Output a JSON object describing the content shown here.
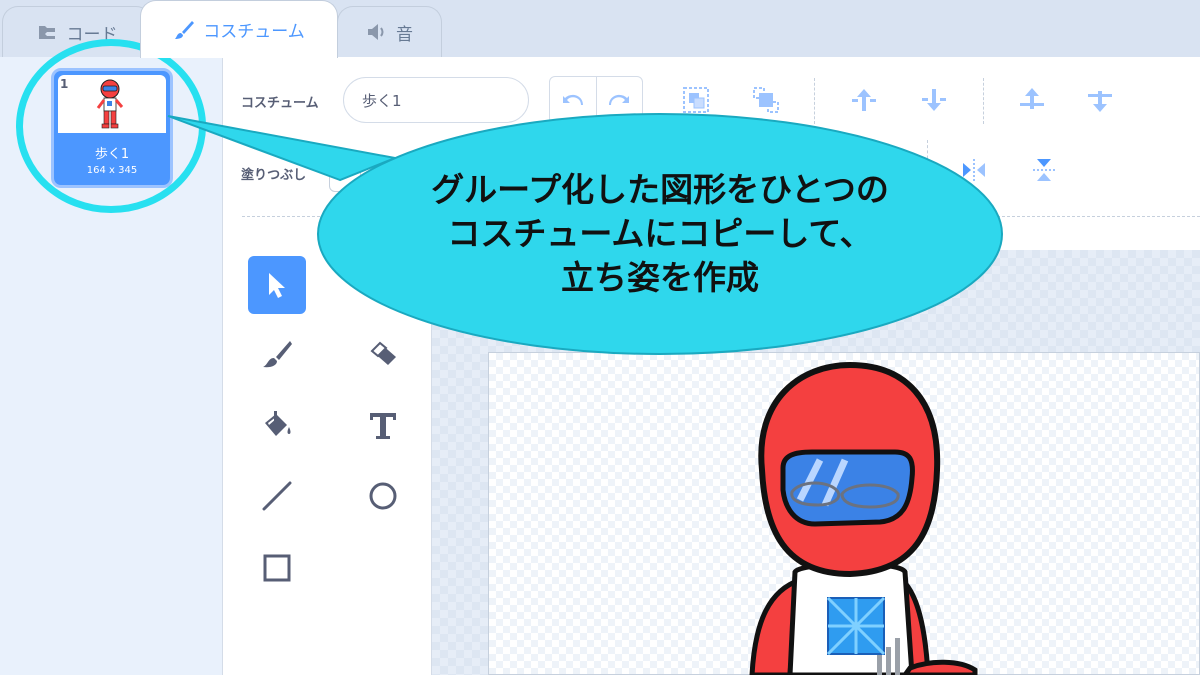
{
  "tabs": [
    {
      "label": "コード",
      "icon": "code-blocks-icon"
    },
    {
      "label": "コスチューム",
      "icon": "paintbrush-icon"
    },
    {
      "label": "音",
      "icon": "speaker-icon"
    }
  ],
  "costume_list": {
    "items": [
      {
        "number": "1",
        "name": "歩く1",
        "size": "164 x 345",
        "selected": true
      }
    ]
  },
  "editor": {
    "costume_label": "コスチューム",
    "costume_name": "歩く1",
    "fill_label": "塗りつぶし"
  },
  "tools": [
    {
      "name": "select-tool",
      "icon": "arrow-pointer-icon",
      "active": true
    },
    {
      "name": "brush-tool",
      "icon": "paintbrush-icon"
    },
    {
      "name": "eraser-tool",
      "icon": "eraser-icon"
    },
    {
      "name": "fill-tool",
      "icon": "paint-bucket-icon"
    },
    {
      "name": "text-tool",
      "icon": "text-t-icon"
    },
    {
      "name": "line-tool",
      "icon": "line-icon"
    },
    {
      "name": "circle-tool",
      "icon": "circle-icon"
    },
    {
      "name": "rectangle-tool",
      "icon": "rectangle-icon"
    }
  ],
  "callout": {
    "lines": [
      "グループ化した図形をひとつの",
      "コスチュームにコピーして、",
      "立ち姿を作成"
    ]
  },
  "colors": {
    "accent": "#4c97ff",
    "highlight": "#27e0f0",
    "callout_fill": "#2fd7ec",
    "character_red": "#f44040",
    "visor_blue": "#3b82e6"
  }
}
